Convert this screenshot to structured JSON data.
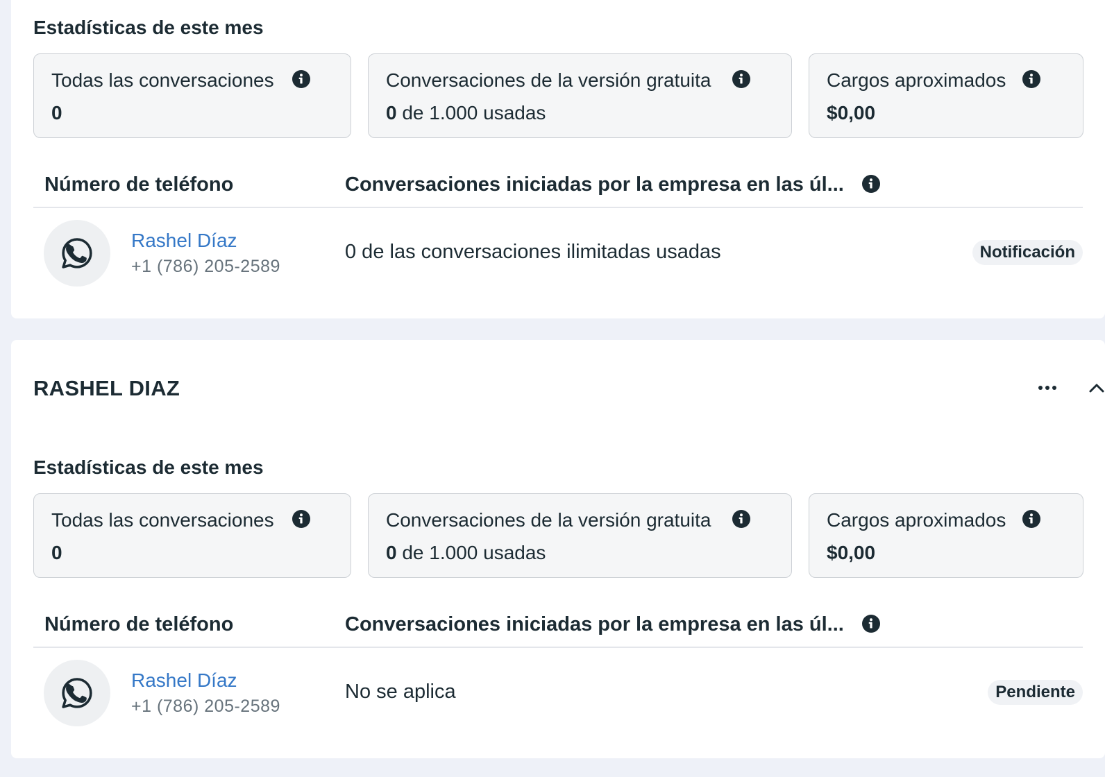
{
  "sections": [
    {
      "stats_title": "Estadísticas de este mes",
      "cards": [
        {
          "label": "Todas las conversaciones",
          "value_bold": "0",
          "value_rest": "",
          "info_icon": "info-icon"
        },
        {
          "label": "Conversaciones de la versión gratuita",
          "value_bold": "0",
          "value_rest": " de 1.000 usadas",
          "info_icon": "info-icon"
        },
        {
          "label": "Cargos aproximados",
          "value_bold": "$0,00",
          "value_rest": "",
          "info_icon": "info-icon"
        }
      ],
      "table": {
        "col_phone": "Número de teléfono",
        "col_conversations": "Conversaciones iniciadas por la empresa en las úl...",
        "rows": [
          {
            "icon": "whatsapp-icon",
            "name": "Rashel Díaz",
            "phone": "+1 (786) 205-2589",
            "usage": "0 de las conversaciones ilimitadas usadas",
            "status": "Notificación"
          }
        ]
      }
    },
    {
      "account_name": "RASHEL DIAZ",
      "more_icon": "more-icon",
      "collapse_icon": "chevron-up-icon",
      "stats_title": "Estadísticas de este mes",
      "cards": [
        {
          "label": "Todas las conversaciones",
          "value_bold": "0",
          "value_rest": "",
          "info_icon": "info-icon"
        },
        {
          "label": "Conversaciones de la versión gratuita",
          "value_bold": "0",
          "value_rest": " de 1.000 usadas",
          "info_icon": "info-icon"
        },
        {
          "label": "Cargos aproximados",
          "value_bold": "$0,00",
          "value_rest": "",
          "info_icon": "info-icon"
        }
      ],
      "table": {
        "col_phone": "Número de teléfono",
        "col_conversations": "Conversaciones iniciadas por la empresa en las úl...",
        "rows": [
          {
            "icon": "whatsapp-icon",
            "name": "Rashel Díaz",
            "phone": "+1 (786) 205-2589",
            "usage": "No se aplica",
            "status": "Pendiente"
          }
        ]
      }
    }
  ],
  "colors": {
    "page_bg": "#eef1f8",
    "card_bg": "#f5f6f7",
    "link": "#3578c7",
    "text": "#1c2b33",
    "muted": "#67737c"
  }
}
